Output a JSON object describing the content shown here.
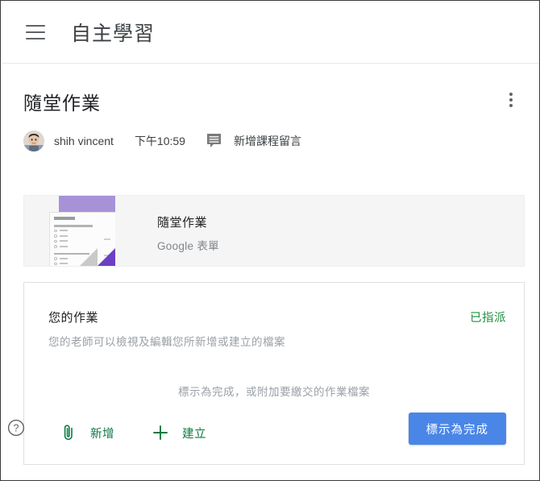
{
  "appbar": {
    "menu_icon": "hamburger-menu-icon",
    "title": "自主學習"
  },
  "assignment": {
    "title": "隨堂作業",
    "overflow_icon": "more-vert-icon",
    "author": "shih vincent",
    "time": "下午10:59",
    "comment_icon": "comment-icon",
    "comment_label": "新增課程留言"
  },
  "attachment": {
    "title": "隨堂作業",
    "subtitle": "Google 表單",
    "thumbnail_icon": "google-forms-thumbnail"
  },
  "work": {
    "title": "您的作業",
    "status": "已指派",
    "subtitle": "您的老師可以檢視及編輯您所新增或建立的檔案",
    "hint": "標示為完成，或附加要繳交的作業檔案",
    "help_icon": "help-circle-icon",
    "add_icon": "paperclip-icon",
    "add_label": "新增",
    "create_icon": "plus-icon",
    "create_label": "建立",
    "done_label": "標示為完成"
  },
  "colors": {
    "accent_blue": "#4a86e8",
    "status_green": "#1e8e3e",
    "action_green": "#0b7a42",
    "forms_purple": "#6c3fc4",
    "thumb_band": "#a792d8",
    "card_grey": "#f5f5f5",
    "muted_text": "#9aa0a6"
  }
}
